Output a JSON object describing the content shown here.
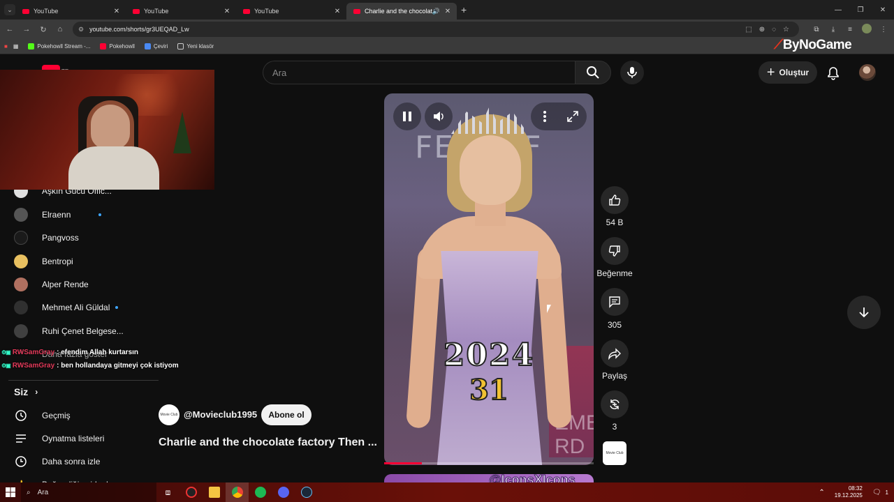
{
  "browser": {
    "tabs": [
      {
        "label": "YouTube",
        "active": false
      },
      {
        "label": "YouTube",
        "active": false
      },
      {
        "label": "YouTube",
        "active": false
      },
      {
        "label": "Charlie and the chocolate f...",
        "active": true
      }
    ],
    "url": "youtube.com/shorts/gr3UEQAD_Lw",
    "bookmarks": [
      {
        "label": "Pokehowll Stream -...",
        "icon": "kick-icon",
        "color": "#53fc18"
      },
      {
        "label": "Pokehowll",
        "icon": "youtube-icon",
        "color": "#ff0033"
      },
      {
        "label": "Çeviri",
        "icon": "translate-icon",
        "color": "#4a8af4"
      },
      {
        "label": "Yeni klasör",
        "icon": "folder-icon",
        "color": "#cccccc"
      }
    ]
  },
  "overlay": {
    "brand": "ByNoGame",
    "chat": [
      {
        "user": "RWSamGray",
        "message": ": efendim Allah kurtarsın"
      },
      {
        "user": "RWSamGray",
        "message": ": ben hollandaya gitmeyi çok istiyom"
      }
    ]
  },
  "youtube": {
    "country_code": "TR",
    "search_placeholder": "Ara",
    "create_label": "Oluştur",
    "sidebar": {
      "channels": [
        {
          "name": "Aşkın Gücü Offic...",
          "live": false,
          "color": "#e0e0e0"
        },
        {
          "name": "Elraenn",
          "live": true,
          "color": "#555555"
        },
        {
          "name": "Pangvoss",
          "live": false,
          "color": "#1a1a1a"
        },
        {
          "name": "Bentropi",
          "live": false,
          "color": "#e8c060"
        },
        {
          "name": "Alper Rende",
          "live": false,
          "color": "#b07060"
        },
        {
          "name": "Mehmet Ali Güldal",
          "live": true,
          "color": "#303030"
        },
        {
          "name": "Ruhi Çenet Belgese...",
          "live": false,
          "color": "#404040"
        }
      ],
      "show_more": "Daha fazla göster",
      "you_section": "Siz",
      "you_items": [
        {
          "label": "Geçmiş",
          "icon": "history-icon"
        },
        {
          "label": "Oynatma listeleri",
          "icon": "playlists-icon"
        },
        {
          "label": "Daha sonra izle",
          "icon": "watch-later-icon"
        },
        {
          "label": "Beğendiğin videolar",
          "icon": "like-icon"
        }
      ]
    },
    "short": {
      "overlay_year": "2024",
      "overlay_age": "31",
      "progress": 0.18,
      "channel": "@Movieclub1995",
      "channel_avatar_text": "Movie Club",
      "subscribe": "Abone ol",
      "title": "Charlie and the chocolate factory Then ...",
      "next_preview_text": "@IconsXIcons"
    },
    "actions": {
      "likes": "54 B",
      "dislike": "Beğenme",
      "comments": "305",
      "share": "Paylaş",
      "remix": "3"
    }
  },
  "taskbar": {
    "search": "Ara",
    "time": "08:32",
    "date": "19.12.2025",
    "notifications": "1"
  }
}
